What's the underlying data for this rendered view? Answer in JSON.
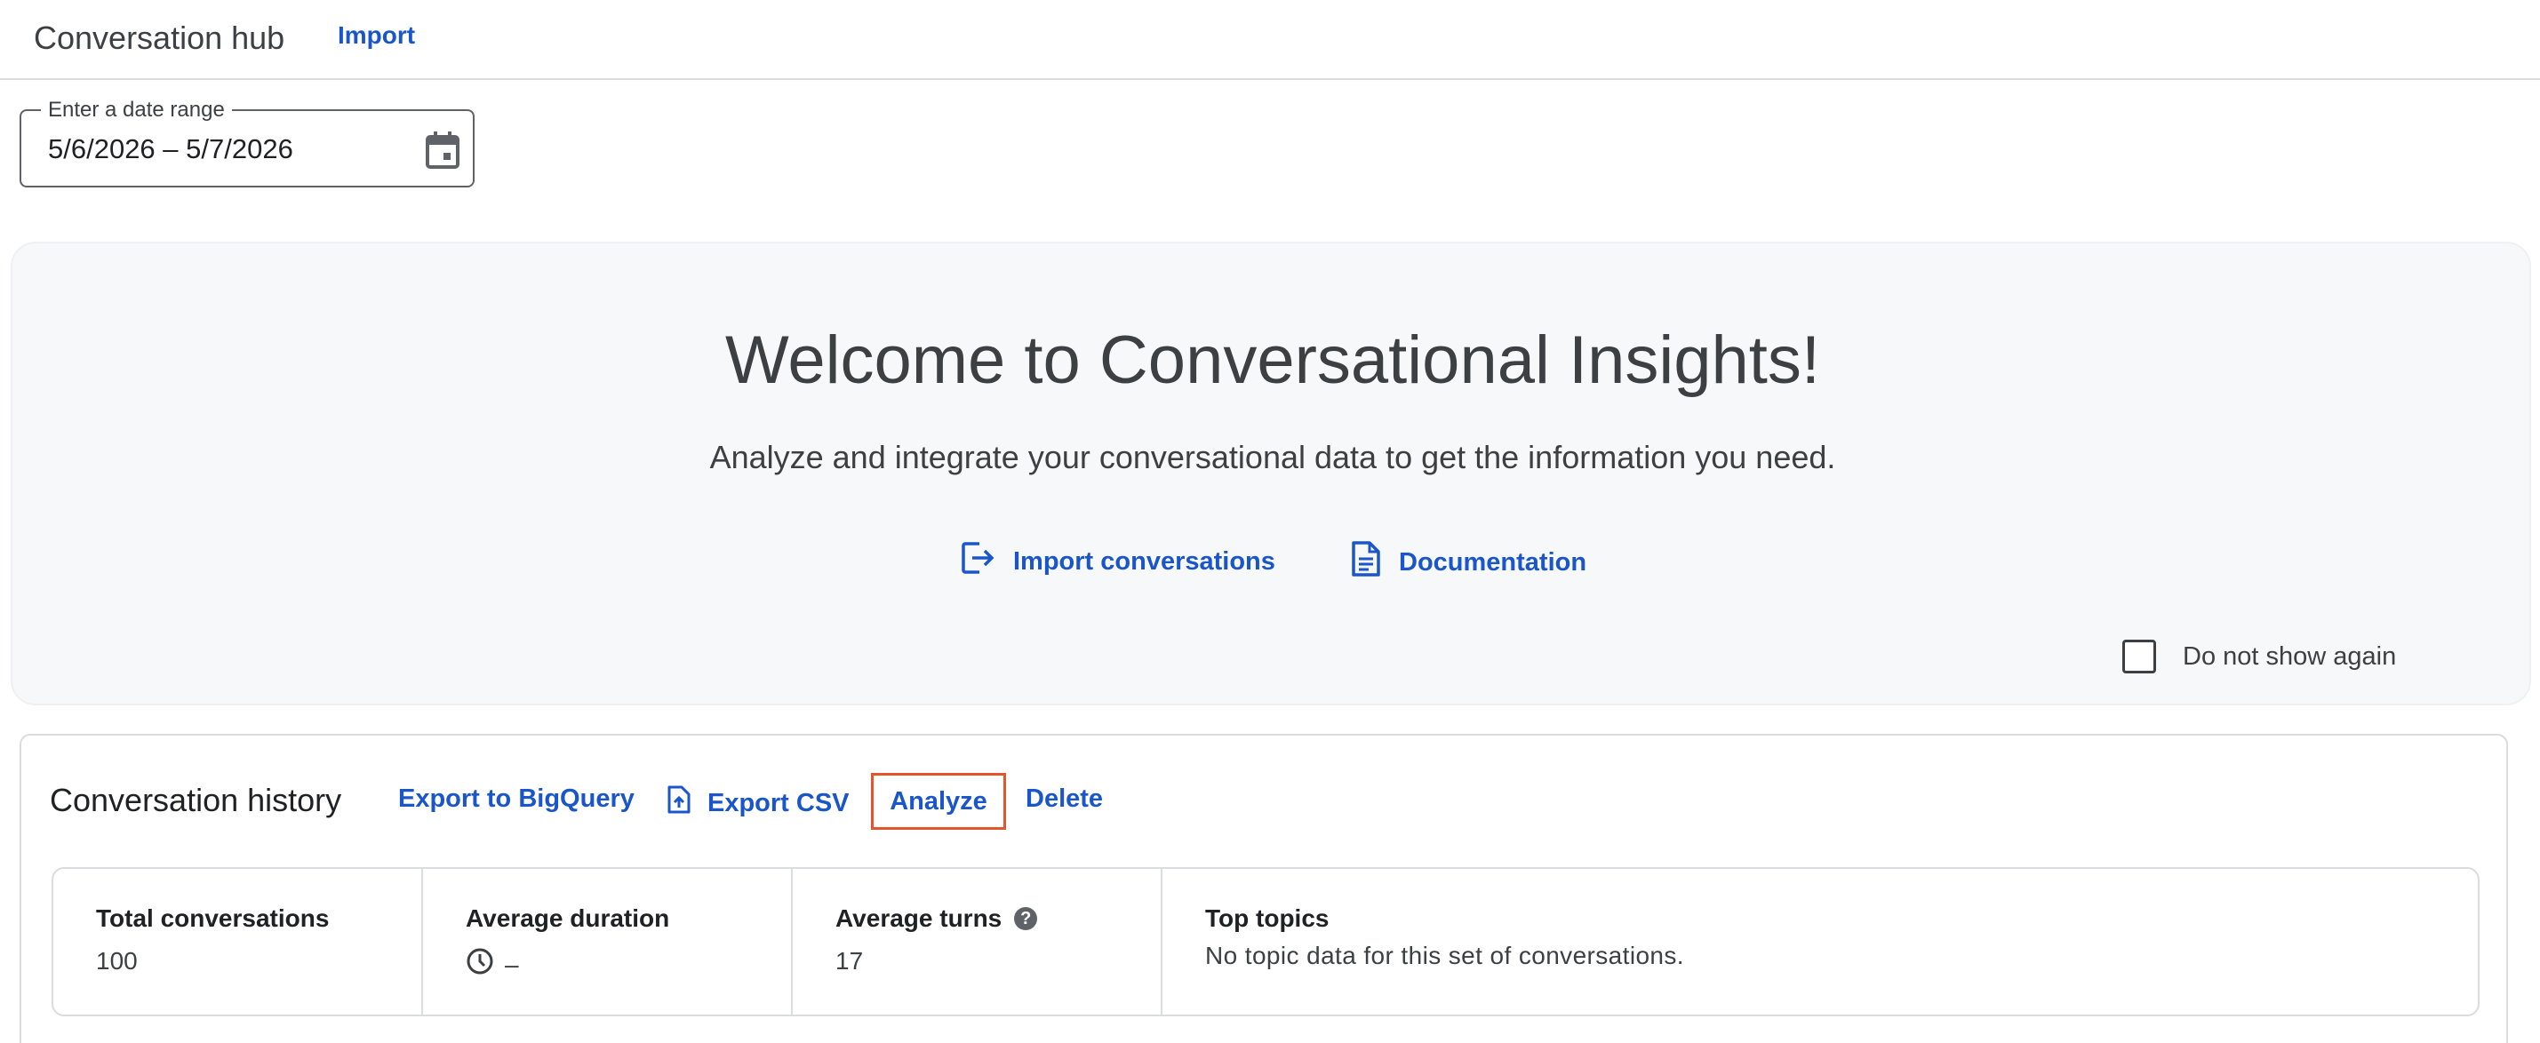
{
  "header": {
    "title": "Conversation hub",
    "import_link": "Import"
  },
  "date_range": {
    "label": "Enter a date range",
    "value": "5/6/2026 – 5/7/2026"
  },
  "welcome": {
    "title": "Welcome to Conversational Insights!",
    "subtitle": "Analyze and integrate your conversational data to get the information you need.",
    "import_label": "Import conversations",
    "docs_label": "Documentation",
    "do_not_show_label": "Do not show again",
    "do_not_show_checked": false
  },
  "history": {
    "title": "Conversation history",
    "actions": {
      "export_bq": "Export to BigQuery",
      "export_csv": "Export CSV",
      "analyze": "Analyze",
      "delete": "Delete"
    },
    "stats": {
      "total": {
        "label": "Total conversations",
        "value": "100"
      },
      "duration": {
        "label": "Average duration",
        "value": "–"
      },
      "turns": {
        "label": "Average turns",
        "value": "17"
      },
      "topics": {
        "label": "Top topics",
        "value": "No topic data for this set of conversations."
      }
    }
  },
  "colors": {
    "link": "#1a56c9",
    "highlight": "#e4552e",
    "welcome_bg": "#f7f8fa"
  },
  "icons": [
    "calendar-icon",
    "import-icon",
    "document-icon",
    "checkbox",
    "export-file-icon",
    "help-icon",
    "clock-icon"
  ]
}
